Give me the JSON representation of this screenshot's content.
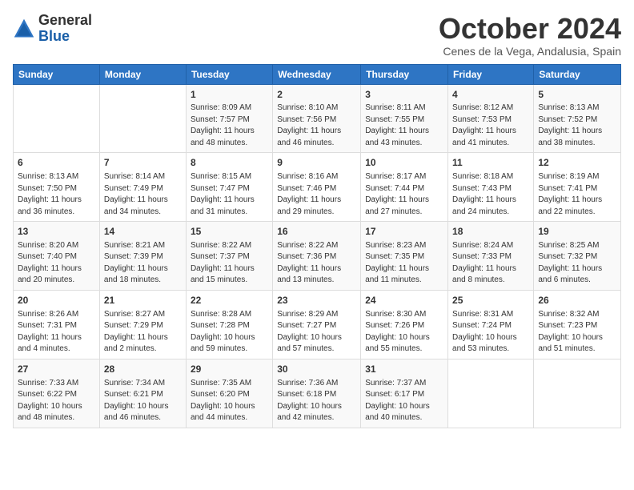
{
  "logo": {
    "general": "General",
    "blue": "Blue"
  },
  "header": {
    "month": "October 2024",
    "location": "Cenes de la Vega, Andalusia, Spain"
  },
  "weekdays": [
    "Sunday",
    "Monday",
    "Tuesday",
    "Wednesday",
    "Thursday",
    "Friday",
    "Saturday"
  ],
  "weeks": [
    [
      {
        "day": "",
        "info": ""
      },
      {
        "day": "",
        "info": ""
      },
      {
        "day": "1",
        "info": "Sunrise: 8:09 AM\nSunset: 7:57 PM\nDaylight: 11 hours and 48 minutes."
      },
      {
        "day": "2",
        "info": "Sunrise: 8:10 AM\nSunset: 7:56 PM\nDaylight: 11 hours and 46 minutes."
      },
      {
        "day": "3",
        "info": "Sunrise: 8:11 AM\nSunset: 7:55 PM\nDaylight: 11 hours and 43 minutes."
      },
      {
        "day": "4",
        "info": "Sunrise: 8:12 AM\nSunset: 7:53 PM\nDaylight: 11 hours and 41 minutes."
      },
      {
        "day": "5",
        "info": "Sunrise: 8:13 AM\nSunset: 7:52 PM\nDaylight: 11 hours and 38 minutes."
      }
    ],
    [
      {
        "day": "6",
        "info": "Sunrise: 8:13 AM\nSunset: 7:50 PM\nDaylight: 11 hours and 36 minutes."
      },
      {
        "day": "7",
        "info": "Sunrise: 8:14 AM\nSunset: 7:49 PM\nDaylight: 11 hours and 34 minutes."
      },
      {
        "day": "8",
        "info": "Sunrise: 8:15 AM\nSunset: 7:47 PM\nDaylight: 11 hours and 31 minutes."
      },
      {
        "day": "9",
        "info": "Sunrise: 8:16 AM\nSunset: 7:46 PM\nDaylight: 11 hours and 29 minutes."
      },
      {
        "day": "10",
        "info": "Sunrise: 8:17 AM\nSunset: 7:44 PM\nDaylight: 11 hours and 27 minutes."
      },
      {
        "day": "11",
        "info": "Sunrise: 8:18 AM\nSunset: 7:43 PM\nDaylight: 11 hours and 24 minutes."
      },
      {
        "day": "12",
        "info": "Sunrise: 8:19 AM\nSunset: 7:41 PM\nDaylight: 11 hours and 22 minutes."
      }
    ],
    [
      {
        "day": "13",
        "info": "Sunrise: 8:20 AM\nSunset: 7:40 PM\nDaylight: 11 hours and 20 minutes."
      },
      {
        "day": "14",
        "info": "Sunrise: 8:21 AM\nSunset: 7:39 PM\nDaylight: 11 hours and 18 minutes."
      },
      {
        "day": "15",
        "info": "Sunrise: 8:22 AM\nSunset: 7:37 PM\nDaylight: 11 hours and 15 minutes."
      },
      {
        "day": "16",
        "info": "Sunrise: 8:22 AM\nSunset: 7:36 PM\nDaylight: 11 hours and 13 minutes."
      },
      {
        "day": "17",
        "info": "Sunrise: 8:23 AM\nSunset: 7:35 PM\nDaylight: 11 hours and 11 minutes."
      },
      {
        "day": "18",
        "info": "Sunrise: 8:24 AM\nSunset: 7:33 PM\nDaylight: 11 hours and 8 minutes."
      },
      {
        "day": "19",
        "info": "Sunrise: 8:25 AM\nSunset: 7:32 PM\nDaylight: 11 hours and 6 minutes."
      }
    ],
    [
      {
        "day": "20",
        "info": "Sunrise: 8:26 AM\nSunset: 7:31 PM\nDaylight: 11 hours and 4 minutes."
      },
      {
        "day": "21",
        "info": "Sunrise: 8:27 AM\nSunset: 7:29 PM\nDaylight: 11 hours and 2 minutes."
      },
      {
        "day": "22",
        "info": "Sunrise: 8:28 AM\nSunset: 7:28 PM\nDaylight: 10 hours and 59 minutes."
      },
      {
        "day": "23",
        "info": "Sunrise: 8:29 AM\nSunset: 7:27 PM\nDaylight: 10 hours and 57 minutes."
      },
      {
        "day": "24",
        "info": "Sunrise: 8:30 AM\nSunset: 7:26 PM\nDaylight: 10 hours and 55 minutes."
      },
      {
        "day": "25",
        "info": "Sunrise: 8:31 AM\nSunset: 7:24 PM\nDaylight: 10 hours and 53 minutes."
      },
      {
        "day": "26",
        "info": "Sunrise: 8:32 AM\nSunset: 7:23 PM\nDaylight: 10 hours and 51 minutes."
      }
    ],
    [
      {
        "day": "27",
        "info": "Sunrise: 7:33 AM\nSunset: 6:22 PM\nDaylight: 10 hours and 48 minutes."
      },
      {
        "day": "28",
        "info": "Sunrise: 7:34 AM\nSunset: 6:21 PM\nDaylight: 10 hours and 46 minutes."
      },
      {
        "day": "29",
        "info": "Sunrise: 7:35 AM\nSunset: 6:20 PM\nDaylight: 10 hours and 44 minutes."
      },
      {
        "day": "30",
        "info": "Sunrise: 7:36 AM\nSunset: 6:18 PM\nDaylight: 10 hours and 42 minutes."
      },
      {
        "day": "31",
        "info": "Sunrise: 7:37 AM\nSunset: 6:17 PM\nDaylight: 10 hours and 40 minutes."
      },
      {
        "day": "",
        "info": ""
      },
      {
        "day": "",
        "info": ""
      }
    ]
  ]
}
